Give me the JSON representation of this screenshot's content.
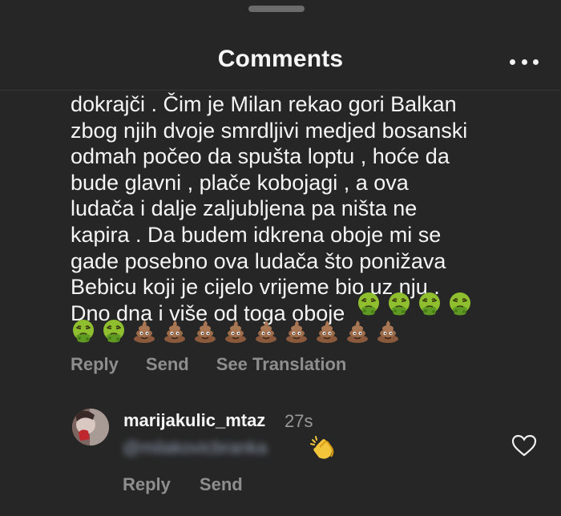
{
  "header": {
    "title": "Comments",
    "more_icon": "more-horizontal-icon"
  },
  "comment": {
    "text_lines": [
      "dokrajči . Čim je Milan rekao gori Balkan",
      "zbog njih dvoje smrdljivi medjed bosanski",
      "odmah počeo da spušta loptu , hoće da",
      "bude glavni , plače kobojagi , a ova",
      "ludača i dalje zaljubljena pa ništa ne",
      "kapira . Da budem idkrena oboje mi se",
      "gade posebno ova ludača što ponižava",
      "Bebicu koji je cijelo vrijeme bio uz nju .",
      "Dno dna i više od toga oboje"
    ],
    "emojis_row1": [
      "nauseated-face",
      "nauseated-face",
      "nauseated-face",
      "nauseated-face"
    ],
    "emojis_row2": [
      "nauseated-face",
      "nauseated-face",
      "pile-of-poo",
      "pile-of-poo",
      "pile-of-poo",
      "pile-of-poo",
      "pile-of-poo",
      "pile-of-poo",
      "pile-of-poo",
      "pile-of-poo",
      "pile-of-poo"
    ],
    "actions": {
      "reply": "Reply",
      "send": "Send",
      "see_translation": "See Translation"
    }
  },
  "reply_comment": {
    "username": "marijakulic_mtaz",
    "timestamp": "27s",
    "mention": "@milakovicbranka",
    "emoji": "clapping-hands",
    "actions": {
      "reply": "Reply",
      "send": "Send"
    },
    "like_icon": "heart-icon"
  },
  "colors": {
    "background": "#262626",
    "text": "#f5f5f5",
    "muted": "#8e8e8e"
  }
}
